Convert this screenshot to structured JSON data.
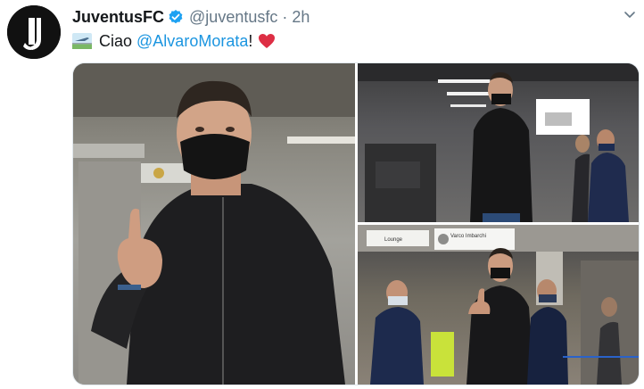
{
  "tweet": {
    "author_name": "JuventusFC",
    "handle": "@juventusfc",
    "separator": "·",
    "time": "2h",
    "text_prefix": "Ciao ",
    "mention": "@AlvaroMorata",
    "text_suffix": "!",
    "emoji_1": "airport-scene-emoji",
    "emoji_2": "red-heart-emoji"
  },
  "colors": {
    "link": "#1b95e0",
    "secondary_text": "#657786",
    "verified_badge": "#1da1f2",
    "heart": "#e0245e"
  },
  "media": {
    "photo_count": 3,
    "photos": [
      {
        "subject": "player-thumbs-up-closeup"
      },
      {
        "subject": "player-walking-airport"
      },
      {
        "subject": "player-thumbs-up-with-security"
      }
    ],
    "signs": {
      "sign_text_1": "Varco Imbarchi",
      "sign_text_2": "Lounge"
    }
  }
}
